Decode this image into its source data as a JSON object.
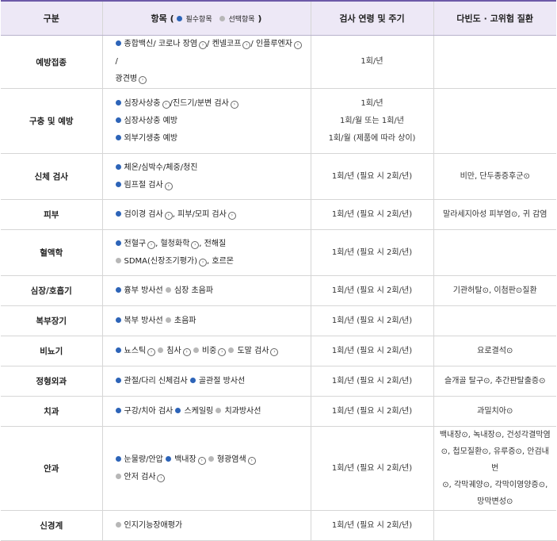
{
  "header": {
    "col1": "구분",
    "col2_title": "항목 (",
    "col2_required": "필수항목",
    "col2_optional": "선택항목",
    "col2_close": ")",
    "col3": "검사 연령 및 주기",
    "col4": "다빈도 · 고위험 질환"
  },
  "colors": {
    "header_bg": "#ede8f6",
    "required_dot": "#2d64b8",
    "optional_dot": "#b7b7b7",
    "header_border": "#6d5aa8"
  },
  "rows": [
    {
      "cat": "예방접종",
      "freq": [
        "1회/년"
      ],
      "dis": [],
      "lines": [
        [
          {
            "t": "req",
            "x": "종합백신"
          },
          {
            "t": "sep",
            "x": "/ 코로나 장염"
          },
          {
            "t": "ico"
          },
          {
            "t": "sep",
            "x": "/ 켄넬코프"
          },
          {
            "t": "ico"
          },
          {
            "t": "sep",
            "x": "/ 인플루엔자"
          },
          {
            "t": "ico"
          },
          {
            "t": "sep",
            "x": "/"
          }
        ],
        [
          {
            "t": "sep",
            "x": "광견병"
          },
          {
            "t": "ico"
          }
        ]
      ]
    },
    {
      "cat": "구충 및 예방",
      "freq": [
        "1회/년",
        "1회/월 또는 1회/년",
        "1회/월 (제품에 따라 상이)"
      ],
      "dis": [],
      "lines": [
        [
          {
            "t": "req",
            "x": "심장사상충"
          },
          {
            "t": "ico"
          },
          {
            "t": "sep",
            "x": "/진드기/분변 검사"
          },
          {
            "t": "ico"
          }
        ],
        [
          {
            "t": "req",
            "x": "심장사상충 예방"
          }
        ],
        [
          {
            "t": "req",
            "x": "외부기생충 예방"
          }
        ]
      ]
    },
    {
      "cat": "신체 검사",
      "freq": [
        "1회/년 (필요 시 2회/년)"
      ],
      "dis": [
        "비만, 단두종증후군⊙"
      ],
      "lines": [
        [
          {
            "t": "req",
            "x": "체온/심박수/체중/청진"
          }
        ],
        [
          {
            "t": "req",
            "x": "림프절 검사"
          },
          {
            "t": "ico"
          }
        ]
      ]
    },
    {
      "cat": "피부",
      "freq": [
        "1회/년 (필요 시 2회/년)"
      ],
      "dis": [
        "말라세지아성 피부염⊙, 귀 감염"
      ],
      "lines": [
        [
          {
            "t": "req",
            "x": "검이경 검사"
          },
          {
            "t": "ico"
          },
          {
            "t": "sep",
            "x": ", 피부/모피 검사"
          },
          {
            "t": "ico"
          }
        ]
      ]
    },
    {
      "cat": "혈액학",
      "freq": [
        "1회/년 (필요 시 2회/년)"
      ],
      "dis": [],
      "lines": [
        [
          {
            "t": "req",
            "x": "전혈구"
          },
          {
            "t": "ico"
          },
          {
            "t": "sep",
            "x": ", 혈청화학"
          },
          {
            "t": "ico"
          },
          {
            "t": "sep",
            "x": ", 전해질"
          }
        ],
        [
          {
            "t": "opt",
            "x": "SDMA(신장조기평가)"
          },
          {
            "t": "ico"
          },
          {
            "t": "sep",
            "x": ", 호르몬"
          }
        ]
      ]
    },
    {
      "cat": "심장/호흡기",
      "freq": [
        "1회/년 (필요 시 2회/년)"
      ],
      "dis": [
        "기관허탈⊙, 이첨판⊙질환"
      ],
      "lines": [
        [
          {
            "t": "req",
            "x": "흉부 방사선"
          },
          {
            "t": "opt",
            "x": "심장 초음파"
          }
        ]
      ]
    },
    {
      "cat": "복부장기",
      "freq": [
        "1회/년 (필요 시 2회/년)"
      ],
      "dis": [],
      "lines": [
        [
          {
            "t": "req",
            "x": "복부 방사선"
          },
          {
            "t": "opt",
            "x": "초음파"
          }
        ]
      ]
    },
    {
      "cat": "비뇨기",
      "freq": [
        "1회/년 (필요 시 2회/년)"
      ],
      "dis": [
        "요로결석⊙"
      ],
      "lines": [
        [
          {
            "t": "req",
            "x": "뇨스틱"
          },
          {
            "t": "ico"
          },
          {
            "t": "opt",
            "x": "침사"
          },
          {
            "t": "ico"
          },
          {
            "t": "opt",
            "x": "비중"
          },
          {
            "t": "ico"
          },
          {
            "t": "opt",
            "x": "도말 검사"
          },
          {
            "t": "ico"
          }
        ]
      ]
    },
    {
      "cat": "정형외과",
      "freq": [
        "1회/년 (필요 시 2회/년)"
      ],
      "dis": [
        "슬개골 탈구⊙, 추간판탈출증⊙"
      ],
      "lines": [
        [
          {
            "t": "req",
            "x": "관절/다리 신체검사"
          },
          {
            "t": "req",
            "x": "골관절 방사선"
          }
        ]
      ]
    },
    {
      "cat": "치과",
      "freq": [
        "1회/년 (필요 시 2회/년)"
      ],
      "dis": [
        "과밀치아⊙"
      ],
      "lines": [
        [
          {
            "t": "req",
            "x": "구강/치아 검사"
          },
          {
            "t": "req",
            "x": "스케일링"
          },
          {
            "t": "opt",
            "x": "치과방사선"
          }
        ]
      ]
    },
    {
      "cat": "안과",
      "freq": [
        "1회/년 (필요 시 2회/년)"
      ],
      "dis": [
        "백내장⊙, 녹내장⊙, 건성각결막염",
        "⊙, 첩모질환⊙, 유루증⊙, 안검내번",
        "⊙, 각막궤양⊙, 각막이영양증⊙,",
        "망막변성⊙"
      ],
      "lines": [
        [
          {
            "t": "req",
            "x": "눈물량/안압"
          },
          {
            "t": "req",
            "x": "백내장"
          },
          {
            "t": "ico"
          },
          {
            "t": "opt",
            "x": "형광염색"
          },
          {
            "t": "ico"
          }
        ],
        [
          {
            "t": "opt",
            "x": "안저 검사"
          },
          {
            "t": "ico"
          }
        ]
      ]
    },
    {
      "cat": "신경계",
      "freq": [
        "1회/년 (필요 시 2회/년)"
      ],
      "dis": [],
      "lines": [
        [
          {
            "t": "opt",
            "x": "인지기능장애평가"
          }
        ]
      ]
    }
  ]
}
